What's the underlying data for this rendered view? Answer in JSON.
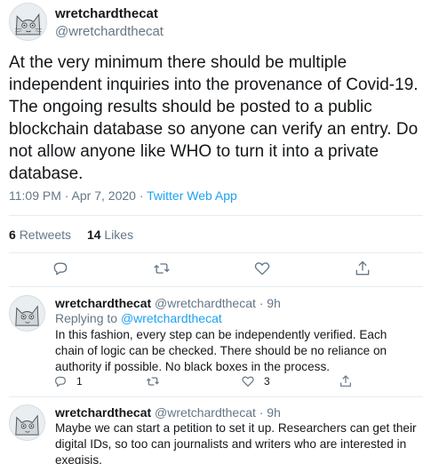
{
  "main_tweet": {
    "display_name": "wretchardthecat",
    "handle": "@wretchardthecat",
    "text": "At the very minimum there should be multiple independent inquiries into the provenance of Covid-19. The ongoing results should be posted to a public blockchain database so anyone can verify an entry. Do not allow anyone like WHO to turn it into a private database.",
    "timestamp": "11:09 PM · Apr 7, 2020 · ",
    "source_app": "Twitter Web App",
    "retweets_count": "6",
    "retweets_label": "Retweets",
    "likes_count": "14",
    "likes_label": "Likes"
  },
  "replies": [
    {
      "display_name": "wretchardthecat",
      "handle_time": "@wretchardthecat · 9h",
      "replying_prefix": "Replying to ",
      "replying_mention": "@wretchardthecat",
      "text": "In this fashion, every step can be independently verified. Each chain of logic can be checked. There should be no reliance on authority if possible. No black boxes in the process.",
      "reply_count": "1",
      "retweet_count": "",
      "like_count": "3"
    },
    {
      "display_name": "wretchardthecat",
      "handle_time": "@wretchardthecat · 9h",
      "text": "Maybe we can start a petition to set it up. Researchers can get their digital IDs, so too can journalists and writers who are interested in exegisis."
    }
  ],
  "icons": {
    "reply": "reply-icon",
    "retweet": "retweet-icon",
    "like": "heart-icon",
    "share": "share-icon"
  },
  "colors": {
    "accent": "#1da1f2",
    "secondary_text": "#657786",
    "primary_text": "#14171a",
    "divider": "#e6ecf0"
  }
}
